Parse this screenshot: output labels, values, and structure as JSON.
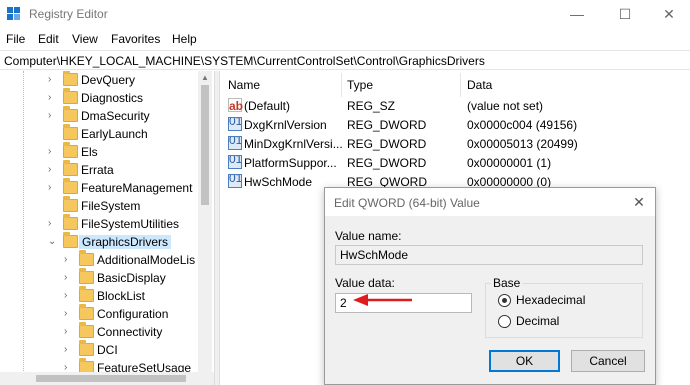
{
  "window": {
    "title": "Registry Editor",
    "minimize": "—",
    "maximize": "☐",
    "close": "✕"
  },
  "menu": [
    "File",
    "Edit",
    "View",
    "Favorites",
    "Help"
  ],
  "address": "Computer\\HKEY_LOCAL_MACHINE\\SYSTEM\\CurrentControlSet\\Control\\GraphicsDrivers",
  "tree": {
    "items": [
      {
        "label": "DevQuery",
        "level": 1,
        "chevron": "›"
      },
      {
        "label": "Diagnostics",
        "level": 1,
        "chevron": "›"
      },
      {
        "label": "DmaSecurity",
        "level": 1,
        "chevron": "›"
      },
      {
        "label": "EarlyLaunch",
        "level": 1,
        "chevron": ""
      },
      {
        "label": "Els",
        "level": 1,
        "chevron": "›"
      },
      {
        "label": "Errata",
        "level": 1,
        "chevron": "›"
      },
      {
        "label": "FeatureManagement",
        "level": 1,
        "chevron": "›"
      },
      {
        "label": "FileSystem",
        "level": 1,
        "chevron": ""
      },
      {
        "label": "FileSystemUtilities",
        "level": 1,
        "chevron": "›"
      },
      {
        "label": "GraphicsDrivers",
        "level": 1,
        "chevron": "⌄",
        "selected": true
      },
      {
        "label": "AdditionalModeLis",
        "level": 2,
        "chevron": "›"
      },
      {
        "label": "BasicDisplay",
        "level": 2,
        "chevron": "›"
      },
      {
        "label": "BlockList",
        "level": 2,
        "chevron": "›"
      },
      {
        "label": "Configuration",
        "level": 2,
        "chevron": "›"
      },
      {
        "label": "Connectivity",
        "level": 2,
        "chevron": "›"
      },
      {
        "label": "DCI",
        "level": 2,
        "chevron": "›"
      },
      {
        "label": "FeatureSetUsage",
        "level": 2,
        "chevron": "›"
      }
    ]
  },
  "list": {
    "headers": {
      "name": "Name",
      "type": "Type",
      "data": "Data"
    },
    "rows": [
      {
        "icon": "string-value-icon",
        "icon_text": "ab",
        "name": "(Default)",
        "type": "REG_SZ",
        "data": "(value not set)"
      },
      {
        "icon": "binary-value-icon",
        "icon_text": "011",
        "name": "DxgKrnlVersion",
        "type": "REG_DWORD",
        "data": "0x0000c004 (49156)"
      },
      {
        "icon": "binary-value-icon",
        "icon_text": "011",
        "name": "MinDxgKrnlVersi...",
        "type": "REG_DWORD",
        "data": "0x00005013 (20499)"
      },
      {
        "icon": "binary-value-icon",
        "icon_text": "011",
        "name": "PlatformSuppor...",
        "type": "REG_DWORD",
        "data": "0x00000001 (1)"
      },
      {
        "icon": "binary-value-icon",
        "icon_text": "011",
        "name": "HwSchMode",
        "type": "REG_QWORD",
        "data": "0x00000000 (0)"
      }
    ]
  },
  "dialog": {
    "title": "Edit QWORD (64-bit) Value",
    "close": "✕",
    "value_name_label": "Value name:",
    "value_name": "HwSchMode",
    "value_data_label": "Value data:",
    "value_data": "2",
    "base_label": "Base",
    "hex_label": "Hexadecimal",
    "dec_label": "Decimal",
    "base_selected": "Hexadecimal",
    "ok": "OK",
    "cancel": "Cancel"
  },
  "colors": {
    "accent": "#0078d7",
    "selection": "#cce8ff",
    "annotation_arrow": "#e01b1b",
    "folder": "#f5c75d"
  }
}
